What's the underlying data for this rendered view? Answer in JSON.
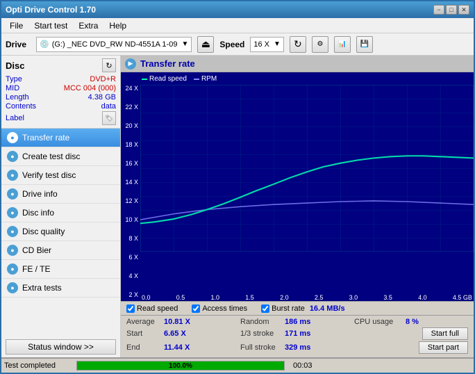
{
  "titleBar": {
    "title": "Opti Drive Control 1.70",
    "minimize": "−",
    "maximize": "□",
    "close": "✕"
  },
  "menuBar": {
    "items": [
      "File",
      "Start test",
      "Extra",
      "Help"
    ]
  },
  "driveBar": {
    "driveLabel": "Drive",
    "driveValue": "(G:)  _NEC DVD_RW ND-4551A 1-09",
    "speedLabel": "Speed",
    "speedValue": "16 X"
  },
  "disc": {
    "title": "Disc",
    "typeLabel": "Type",
    "typeValue": "DVD+R",
    "midLabel": "MID",
    "midValue": "MCC 004 (000)",
    "lengthLabel": "Length",
    "lengthValue": "4.38 GB",
    "contentsLabel": "Contents",
    "contentsValue": "data",
    "labelLabel": "Label"
  },
  "navItems": [
    {
      "id": "transfer-rate",
      "label": "Transfer rate",
      "active": true
    },
    {
      "id": "create-test-disc",
      "label": "Create test disc",
      "active": false
    },
    {
      "id": "verify-test-disc",
      "label": "Verify test disc",
      "active": false
    },
    {
      "id": "drive-info",
      "label": "Drive info",
      "active": false
    },
    {
      "id": "disc-info",
      "label": "Disc info",
      "active": false
    },
    {
      "id": "disc-quality",
      "label": "Disc quality",
      "active": false
    },
    {
      "id": "cd-bier",
      "label": "CD Bier",
      "active": false
    },
    {
      "id": "fe-te",
      "label": "FE / TE",
      "active": false
    },
    {
      "id": "extra-tests",
      "label": "Extra tests",
      "active": false
    }
  ],
  "statusWindowBtn": "Status window >>",
  "chart": {
    "title": "Transfer rate",
    "legend": {
      "readSpeed": "Read speed",
      "rpm": "RPM"
    },
    "yLabels": [
      "24 X",
      "22 X",
      "20 X",
      "18 X",
      "16 X",
      "14 X",
      "12 X",
      "10 X",
      "8 X",
      "6 X",
      "4 X",
      "2 X"
    ],
    "xLabels": [
      "0.0",
      "0.5",
      "1.0",
      "1.5",
      "2.0",
      "2.5",
      "3.0",
      "3.5",
      "4.0",
      "4.5 GB"
    ]
  },
  "checkboxes": {
    "readSpeed": "Read speed",
    "accessTimes": "Access times",
    "burstRate": "Burst rate",
    "burstRateValue": "16.4 MB/s"
  },
  "stats": {
    "averageLabel": "Average",
    "averageValue": "10.81 X",
    "randomLabel": "Random",
    "randomValue": "186 ms",
    "cpuLabel": "CPU usage",
    "cpuValue": "8 %",
    "startLabel": "Start",
    "startValue": "6.65 X",
    "strokeLabel": "1/3 stroke",
    "strokeValue": "171 ms",
    "startFullBtn": "Start full",
    "endLabel": "End",
    "endValue": "11.44 X",
    "fullStrokeLabel": "Full stroke",
    "fullStrokeValue": "329 ms",
    "startPartBtn": "Start part"
  },
  "statusBar": {
    "text": "Test completed",
    "progress": "100.0%",
    "time": "00:03"
  }
}
